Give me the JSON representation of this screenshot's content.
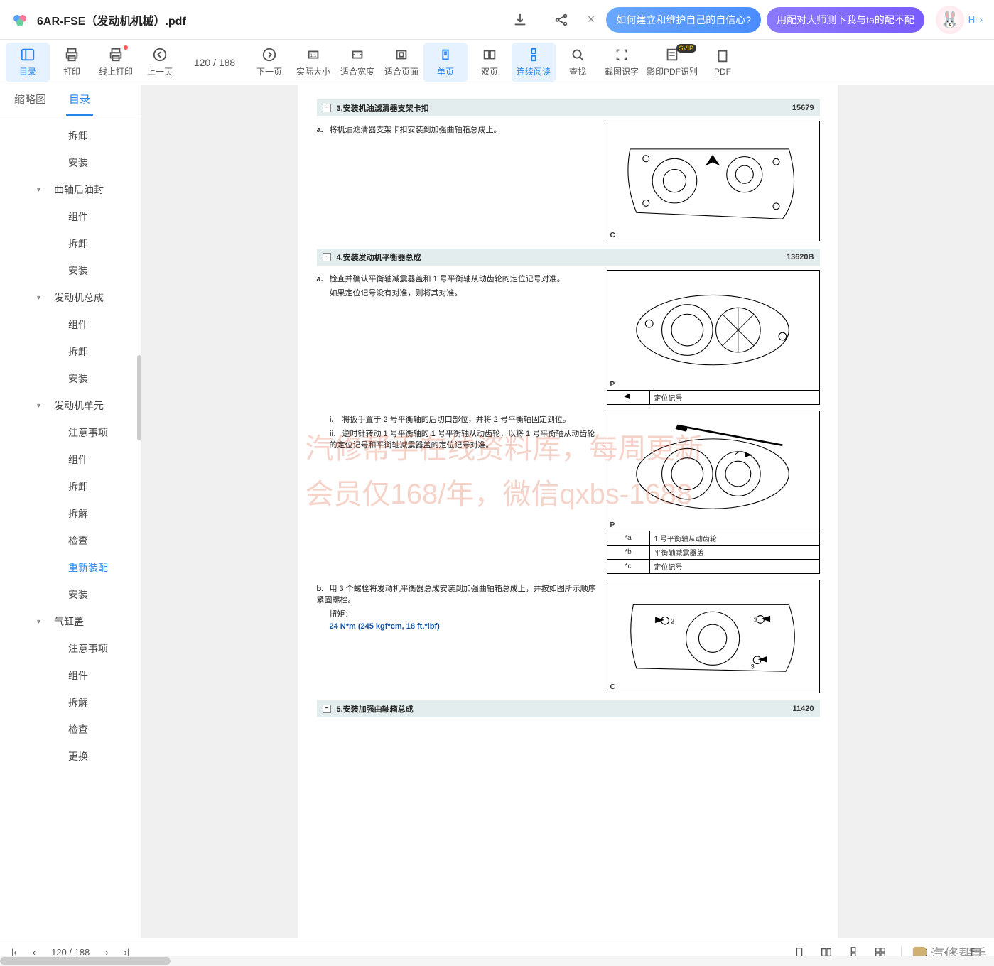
{
  "title": "6AR-FSE（发动机机械）.pdf",
  "promos": {
    "p1": "如何建立和维护自己的自信心?",
    "p2": "用配对大师测下我与ta的配不配",
    "hi": "Hi ›"
  },
  "toolbar": {
    "catalog": "目录",
    "print": "打印",
    "online_print": "线上打印",
    "prev": "上一页",
    "page_ind": "120 / 188",
    "next": "下一页",
    "actual": "实际大小",
    "fitw": "适合宽度",
    "fitp": "适合页面",
    "single": "单页",
    "double": "双页",
    "cont": "连续阅读",
    "search": "查找",
    "snip": "截图识字",
    "ocr": "影印PDF识别",
    "pdf": "PDF",
    "svip": "SVIP"
  },
  "side_tabs": {
    "thumb": "缩略图",
    "toc": "目录"
  },
  "toc": [
    {
      "t": "拆卸",
      "lvl": 2
    },
    {
      "t": "安装",
      "lvl": 2
    },
    {
      "t": "曲轴后油封",
      "lvl": 1,
      "chev": true
    },
    {
      "t": "组件",
      "lvl": 2
    },
    {
      "t": "拆卸",
      "lvl": 2
    },
    {
      "t": "安装",
      "lvl": 2
    },
    {
      "t": "发动机总成",
      "lvl": 1,
      "chev": true
    },
    {
      "t": "组件",
      "lvl": 2
    },
    {
      "t": "拆卸",
      "lvl": 2
    },
    {
      "t": "安装",
      "lvl": 2
    },
    {
      "t": "发动机单元",
      "lvl": 1,
      "chev": true
    },
    {
      "t": "注意事项",
      "lvl": 2
    },
    {
      "t": "组件",
      "lvl": 2
    },
    {
      "t": "拆卸",
      "lvl": 2
    },
    {
      "t": "拆解",
      "lvl": 2
    },
    {
      "t": "检查",
      "lvl": 2
    },
    {
      "t": "重新装配",
      "lvl": 2,
      "sel": true
    },
    {
      "t": "安装",
      "lvl": 2
    },
    {
      "t": "气缸盖",
      "lvl": 1,
      "chev": true
    },
    {
      "t": "注意事项",
      "lvl": 2
    },
    {
      "t": "组件",
      "lvl": 2
    },
    {
      "t": "拆解",
      "lvl": 2
    },
    {
      "t": "检查",
      "lvl": 2
    },
    {
      "t": "更换",
      "lvl": 2
    }
  ],
  "doc": {
    "sec3": {
      "title": "3.安装机油滤清器支架卡扣",
      "code": "15679",
      "a_lbl": "a.",
      "a_txt": "将机油滤清器支架卡扣安装到加强曲轴箱总成上。",
      "corner": "C"
    },
    "sec4": {
      "title": "4.安装发动机平衡器总成",
      "code": "13620B",
      "a_lbl": "a.",
      "a_txt1": "检查并确认平衡轴减震器盖和 1 号平衡轴从动齿轮的定位记号对准。",
      "a_txt2": "如果定位记号没有对准，则将其对准。",
      "corner_p": "P",
      "p_label": "定位记号",
      "i_lbl": "i.",
      "i_txt": "将扳手置于 2 号平衡轴的后切口部位，并将 2 号平衡轴固定到位。",
      "ii_lbl": "ii.",
      "ii_txt": "逆时针转动 1 号平衡轴的 1 号平衡轴从动齿轮，以将 1 号平衡轴从动齿轮的定位记号和平衡轴减震器盖的定位记号对准。",
      "key_a": "*a",
      "key_a_v": "1 号平衡轴从动齿轮",
      "key_b": "*b",
      "key_b_v": "平衡轴减震器盖",
      "key_c": "*c",
      "key_c_v": "定位记号",
      "b_lbl": "b.",
      "b_txt": "用 3 个螺栓将发动机平衡器总成安装到加强曲轴箱总成上，并按如图所示顺序紧固螺栓。",
      "torque_lbl": "扭矩：",
      "torque": "24 N*m (245 kgf*cm, 18 ft.*lbf)",
      "corner_c": "C"
    },
    "sec5": {
      "title": "5.安装加强曲轴箱总成",
      "code": "11420"
    },
    "wm1": "汽修帮手在线资料库，每周更新",
    "wm2": "会员仅168/年，微信qxbs-1688",
    "brand": "汽修帮手"
  },
  "bottom": {
    "page": "120 / 188"
  }
}
